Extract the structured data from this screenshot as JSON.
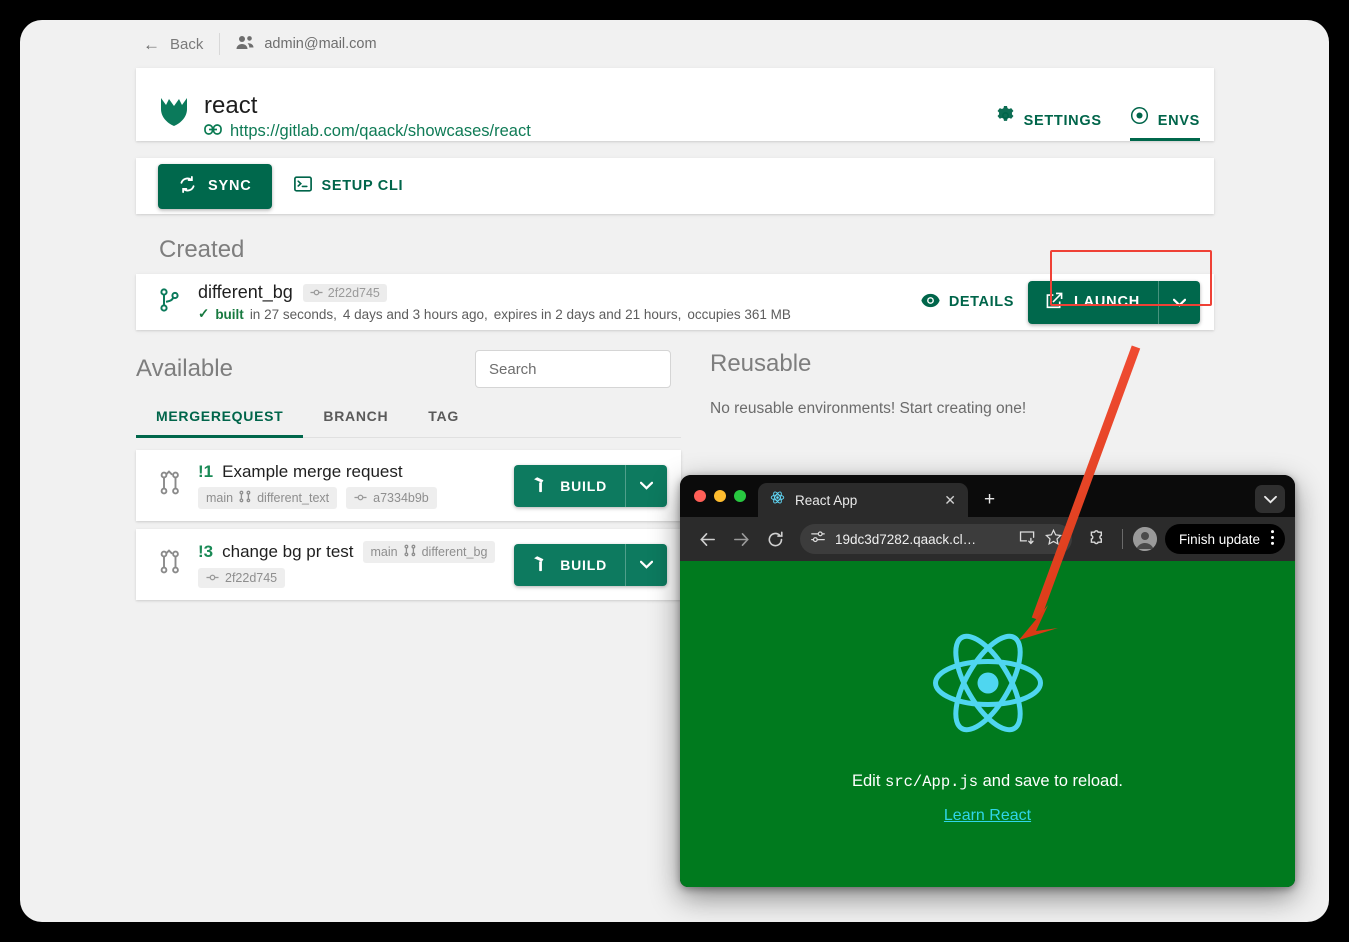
{
  "topbar": {
    "back_label": "Back",
    "back_icon": "arrow-left-icon",
    "user_email": "admin@mail.com",
    "user_icon": "users-icon"
  },
  "project": {
    "logo_icon": "gitlab-fox-icon",
    "name": "react",
    "link_icon": "link-icon",
    "url": "https://gitlab.com/qaack/showcases/react",
    "tabs": [
      {
        "label": "SETTINGS",
        "icon": "gear-icon",
        "active": false
      },
      {
        "label": "ENVS",
        "icon": "target-dot-icon",
        "active": true
      }
    ]
  },
  "toolbar": {
    "sync_label": "SYNC",
    "sync_icon": "sync-icon",
    "setup_cli_label": "SETUP CLI",
    "setup_cli_icon": "terminal-icon"
  },
  "created": {
    "heading": "Created",
    "env": {
      "icon": "branch-icon",
      "name": "different_bg",
      "commit": "2f22d745",
      "commit_icon": "commit-icon",
      "status_check": "✓",
      "status": "built",
      "duration": "in 27 seconds,",
      "age": "4 days and 3 hours ago,",
      "expires": "expires in 2 days and 21 hours,",
      "occupies": "occupies 361 MB",
      "details_label": "DETAILS",
      "details_icon": "eye-icon",
      "launch_label": "LAUNCH",
      "launch_icon": "external-link-icon",
      "launch_caret_icon": "chevron-down-icon"
    },
    "highlight_color": "#ef4136"
  },
  "available": {
    "heading": "Available",
    "search_placeholder": "Search",
    "search_value": "",
    "tabs": [
      {
        "label": "MERGEREQUEST",
        "active": true
      },
      {
        "label": "BRANCH",
        "active": false
      },
      {
        "label": "TAG",
        "active": false
      }
    ],
    "items": [
      {
        "icon": "merge-request-icon",
        "id": "!1",
        "title": "Example merge request",
        "target_branch": "main",
        "branch_icon": "merge-request-icon",
        "source_branch": "different_text",
        "commit_icon": "commit-icon",
        "commit": "a7334b9b",
        "second_line": false,
        "build_label": "BUILD",
        "build_icon": "hammer-icon",
        "build_caret_icon": "chevron-down-icon"
      },
      {
        "icon": "merge-request-icon",
        "id": "!3",
        "title": "change bg pr test",
        "target_branch": "main",
        "branch_icon": "merge-request-icon",
        "source_branch": "different_bg",
        "commit_icon": "commit-icon",
        "commit": "2f22d745",
        "second_line": true,
        "build_label": "BUILD",
        "build_icon": "hammer-icon",
        "build_caret_icon": "chevron-down-icon"
      }
    ]
  },
  "reusable": {
    "heading": "Reusable",
    "empty_text": "No reusable environments! Start creating one!"
  },
  "browser": {
    "traffic_lights": [
      "#ff5f57",
      "#febc2e",
      "#28c840"
    ],
    "tab": {
      "favicon": "react-atom-icon",
      "title": "React App",
      "close_icon": "close-icon"
    },
    "new_tab_icon": "plus-icon",
    "tab_list_icon": "chevron-down-icon",
    "nav": {
      "back_icon": "arrow-left-icon",
      "forward_icon": "arrow-right-icon",
      "reload_icon": "reload-icon"
    },
    "omnibox": {
      "site_settings_icon": "tune-icon",
      "url": "19dc3d7282.qaack.cl…",
      "install_icon": "install-app-icon",
      "bookmark_icon": "star-icon"
    },
    "extensions_icon": "puzzle-icon",
    "profile_icon": "avatar-icon",
    "update": {
      "label": "Finish update",
      "menu_icon": "kebab-menu-icon"
    },
    "content": {
      "background_color": "#007a1e",
      "logo_icon": "react-atom-icon",
      "logo_color": "#61dbfb",
      "edit_prefix": "Edit ",
      "edit_code": "src/App.js",
      "edit_suffix": " and save to reload.",
      "link_label": "Learn React"
    }
  }
}
